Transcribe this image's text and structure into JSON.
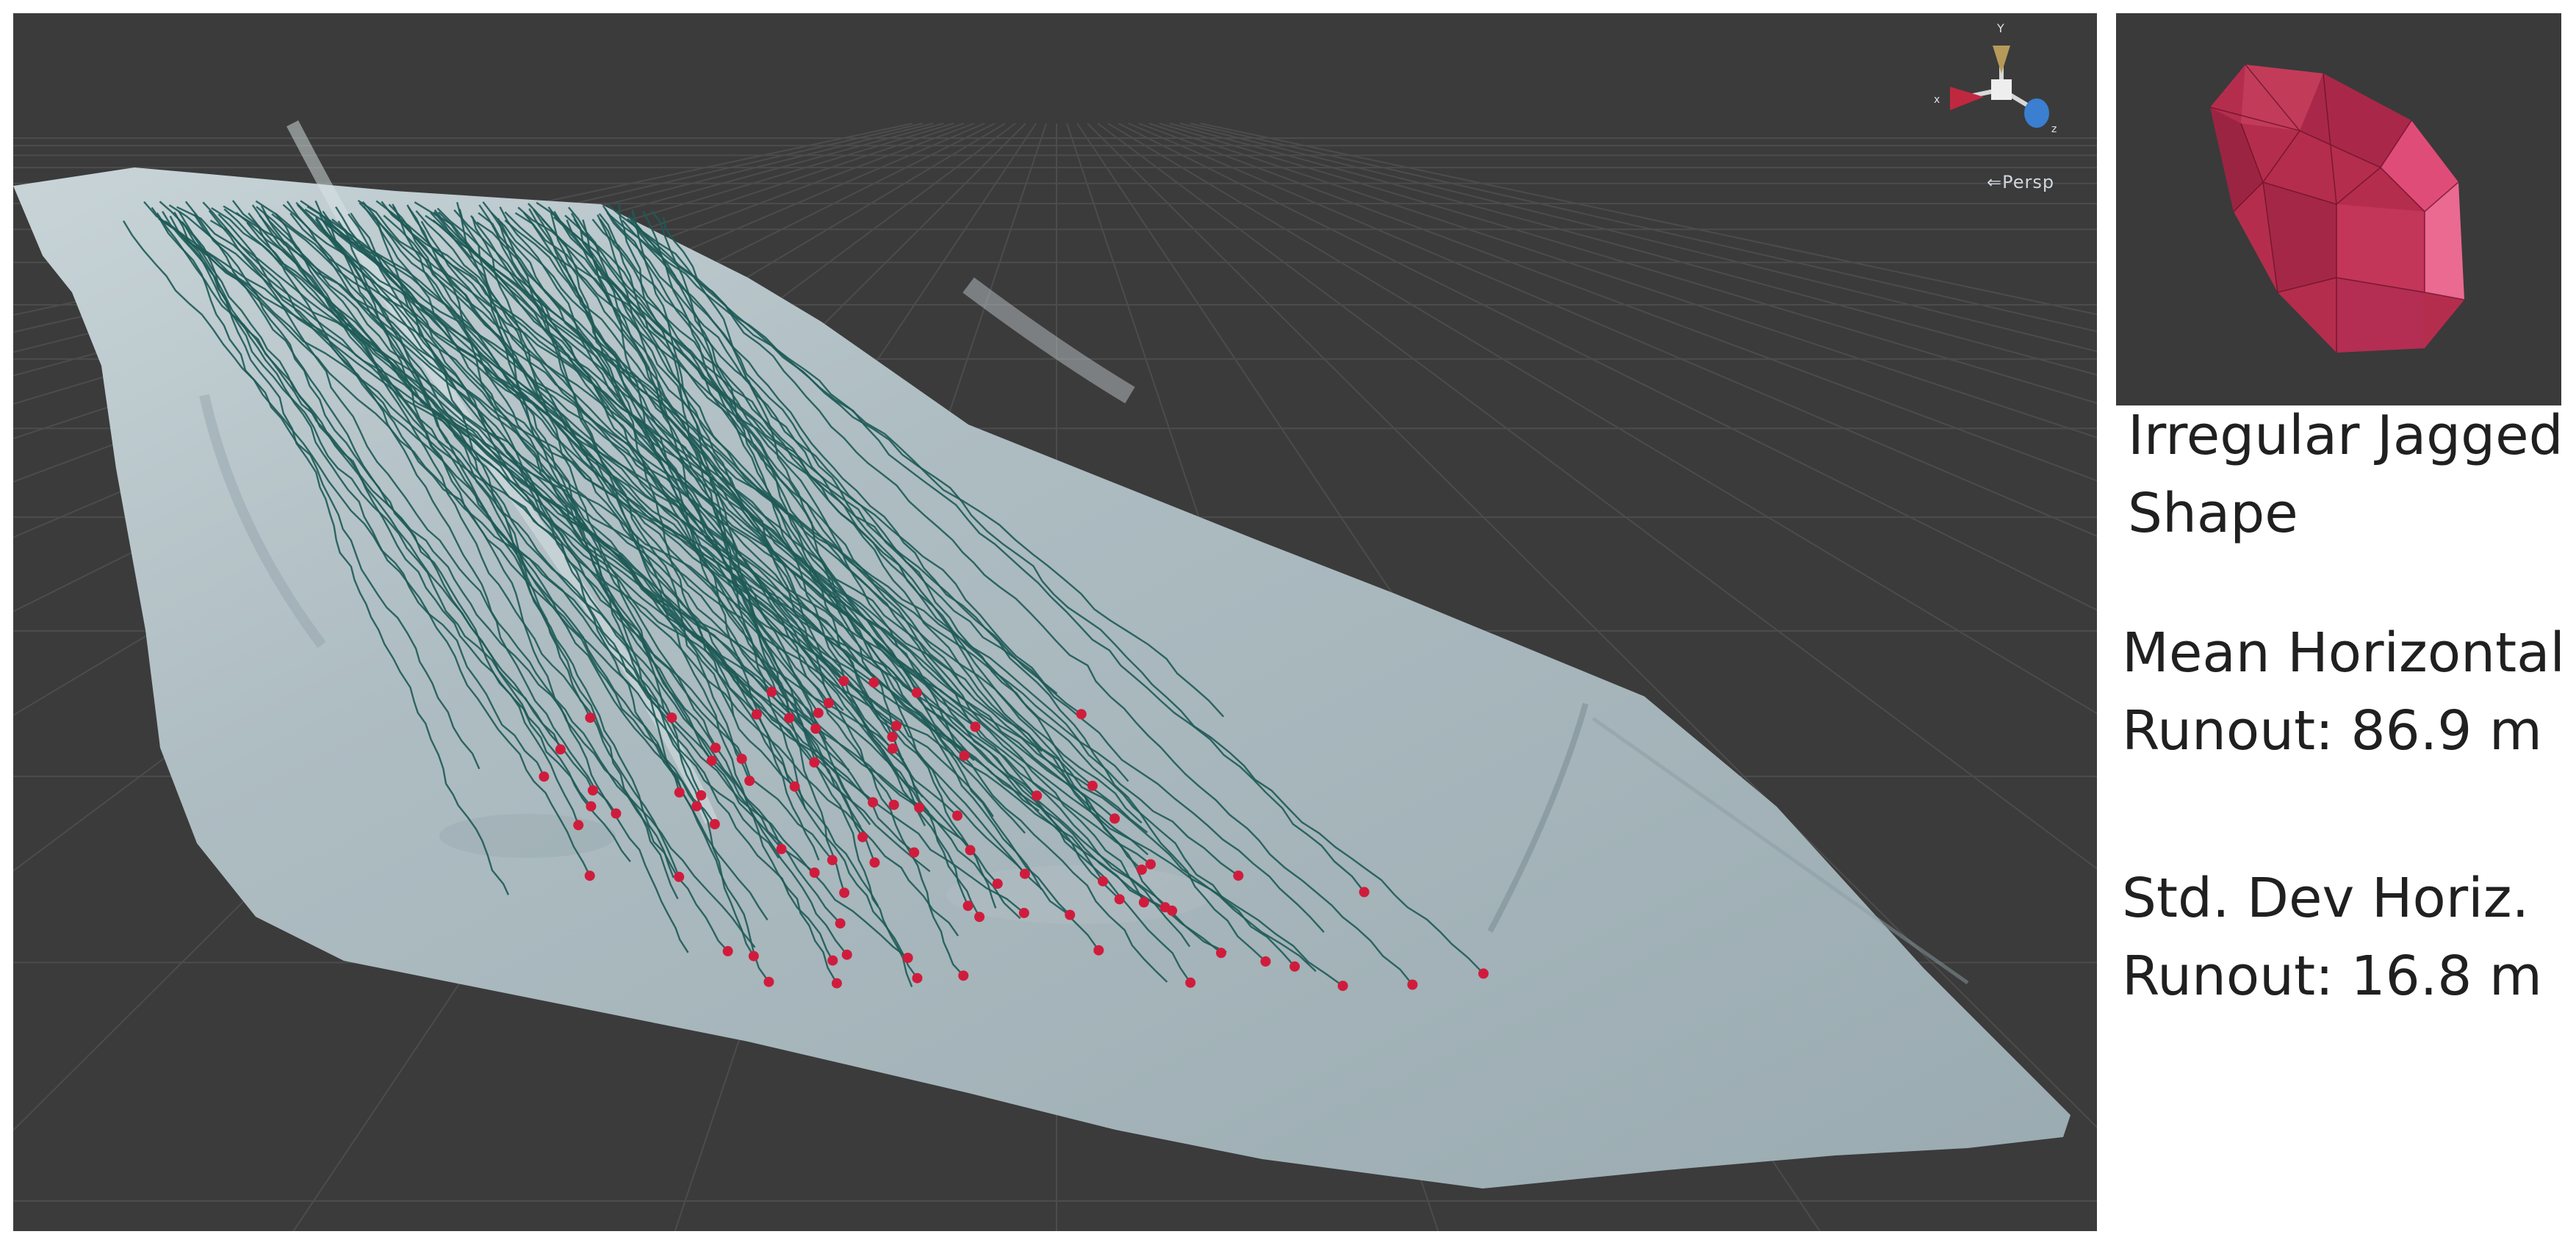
{
  "scene_view": {
    "projection_label": "⇐Persp",
    "axis_labels": {
      "y": "Y",
      "x": "x",
      "z": "z"
    },
    "colors": {
      "background": "#3b3b3b",
      "terrain": "#a8b8be",
      "trajectory": "#1e5a57",
      "endpoint": "#d01c3c"
    }
  },
  "preview": {
    "colors": {
      "background": "#3a3a3a",
      "rock": "#b52d4d"
    }
  },
  "info": {
    "shape_line1": "Irregular Jagged",
    "shape_line2": "Shape",
    "mean_line1": "Mean Horizontal",
    "mean_line2": "Runout: 86.9 m",
    "std_line1": "Std. Dev Horiz.",
    "std_line2": "Runout: 16.8 m"
  }
}
